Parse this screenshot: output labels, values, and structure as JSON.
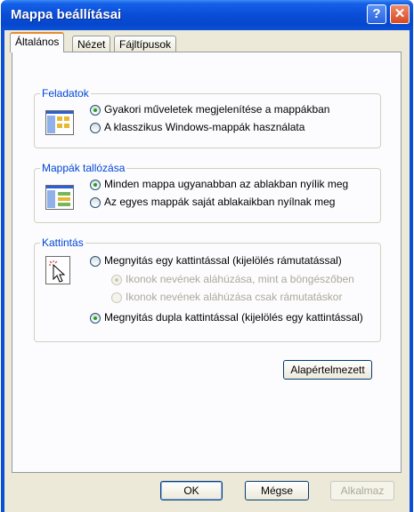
{
  "window": {
    "title": "Mappa beállításai",
    "help_label": "?",
    "close_label": "✕"
  },
  "tabs": [
    {
      "label": "Általános"
    },
    {
      "label": "Nézet"
    },
    {
      "label": "Fájltípusok"
    }
  ],
  "groups": {
    "tasks": {
      "label": "Feladatok",
      "options": [
        {
          "label": "Gyakori műveletek megjelenítése a mappákban",
          "checked": true
        },
        {
          "label": "A klasszikus Windows-mappák használata",
          "checked": false
        }
      ]
    },
    "browse": {
      "label": "Mappák tallózása",
      "options": [
        {
          "label": "Minden mappa ugyanabban az ablakban nyílik meg",
          "checked": true
        },
        {
          "label": "Az egyes mappák saját ablakaikban nyílnak meg",
          "checked": false
        }
      ]
    },
    "click": {
      "label": "Kattintás",
      "options": [
        {
          "label": "Megnyitás egy kattintással (kijelölés rámutatással)",
          "checked": false
        },
        {
          "label": "Ikonok nevének aláhúzása, mint a böngészőben",
          "checked": true,
          "disabled": true
        },
        {
          "label": "Ikonok nevének aláhúzása csak rámutatáskor",
          "checked": false,
          "disabled": true
        },
        {
          "label": "Megnyitás dupla kattintással (kijelölés egy kattintással)",
          "checked": true
        }
      ]
    }
  },
  "buttons": {
    "restore_defaults": "Alapértelmezett",
    "ok": "OK",
    "cancel": "Mégse",
    "apply": "Alkalmaz"
  },
  "colors": {
    "title_bar": "#0a4fd8",
    "group_label": "#0046d5",
    "radio_dot": "#21a121",
    "tab_highlight": "#e68b2c"
  }
}
